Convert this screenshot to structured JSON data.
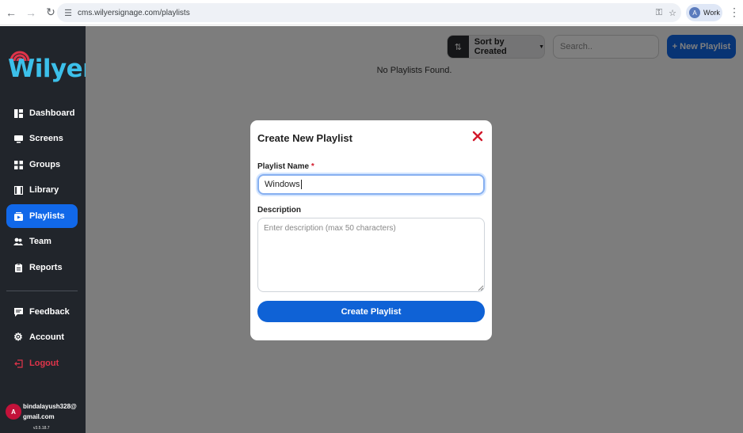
{
  "browser": {
    "url": "cms.wilyersignage.com/playlists",
    "profile_label": "Work",
    "profile_initial": "A"
  },
  "sidebar": {
    "logo_text": "Wilyer",
    "items": [
      {
        "label": "Dashboard",
        "icon": "dashboard-icon"
      },
      {
        "label": "Screens",
        "icon": "monitor-icon"
      },
      {
        "label": "Groups",
        "icon": "grid-icon"
      },
      {
        "label": "Library",
        "icon": "film-icon"
      },
      {
        "label": "Playlists",
        "icon": "playlist-icon",
        "active": true
      },
      {
        "label": "Team",
        "icon": "people-icon"
      },
      {
        "label": "Reports",
        "icon": "clipboard-icon"
      }
    ],
    "bottom_items": [
      {
        "label": "Feedback",
        "icon": "chat-icon"
      },
      {
        "label": "Account",
        "icon": "gear-icon"
      },
      {
        "label": "Logout",
        "icon": "logout-icon"
      }
    ],
    "user_initial": "A",
    "user_email": "bindalayush328@gmail.com",
    "version": "v3.5.18.7"
  },
  "toolbar": {
    "sort_label": "Sort by Created",
    "search_placeholder": "Search..",
    "new_label": "+ New Playlist"
  },
  "main": {
    "empty_message": "No Playlists Found."
  },
  "modal": {
    "title": "Create New Playlist",
    "name_label": "Playlist Name",
    "required_mark": "*",
    "name_value": "Windows",
    "description_label": "Description",
    "description_placeholder": "Enter description (max 50 characters)",
    "submit_label": "Create Playlist"
  },
  "colors": {
    "primary": "#1168e9",
    "sidebar_bg": "#21252b",
    "logo_blue": "#3cc0ea",
    "logo_red": "#e0344a",
    "danger": "#d2182a"
  }
}
